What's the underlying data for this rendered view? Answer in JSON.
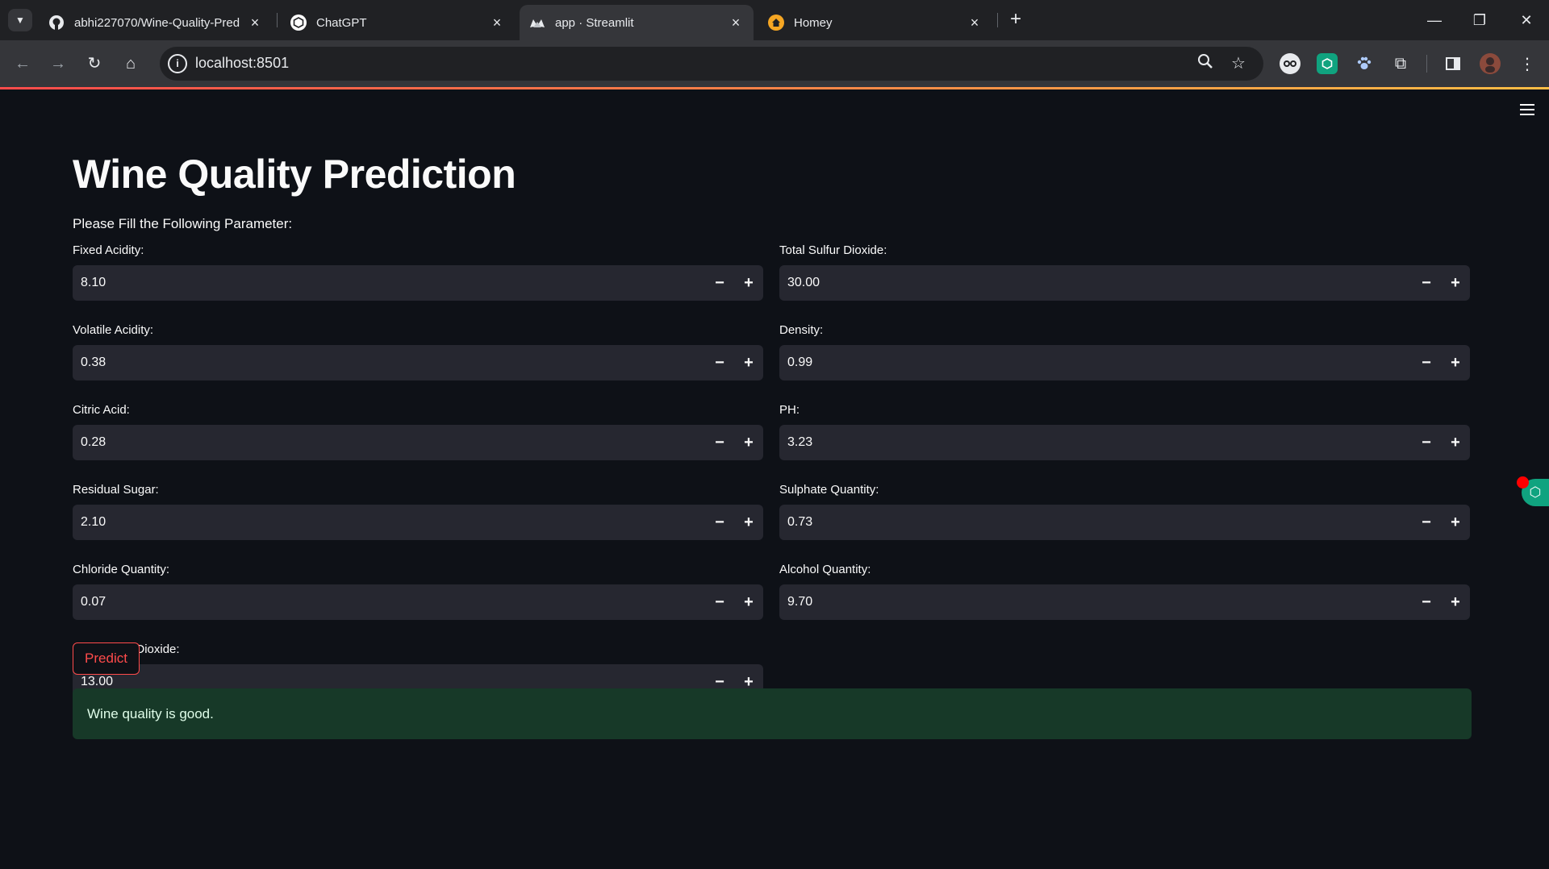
{
  "browser": {
    "tabs": [
      {
        "title": "abhi227070/Wine-Quality-Pred",
        "favicon": "github-icon"
      },
      {
        "title": "ChatGPT",
        "favicon": "chatgpt-icon"
      },
      {
        "title": "app · Streamlit",
        "favicon": "streamlit-icon",
        "active": true
      },
      {
        "title": "Homey",
        "favicon": "homey-icon"
      }
    ],
    "url": "localhost:8501"
  },
  "app": {
    "title": "Wine Quality Prediction",
    "subtitle": "Please Fill the Following Parameter:",
    "left_fields": [
      {
        "label": "Fixed Acidity:",
        "value": "8.10"
      },
      {
        "label": "Volatile Acidity:",
        "value": "0.38"
      },
      {
        "label": "Citric Acid:",
        "value": "0.28"
      },
      {
        "label": "Residual Sugar:",
        "value": "2.10"
      },
      {
        "label": "Chloride Quantity:",
        "value": "0.07"
      },
      {
        "label": "Free Sulfur Dioxide:",
        "value": "13.00"
      }
    ],
    "right_fields": [
      {
        "label": "Total Sulfur Dioxide:",
        "value": "30.00"
      },
      {
        "label": "Density:",
        "value": "0.99"
      },
      {
        "label": "PH:",
        "value": "3.23"
      },
      {
        "label": "Sulphate Quantity:",
        "value": "0.73"
      },
      {
        "label": "Alcohol Quantity:",
        "value": "9.70"
      }
    ],
    "predict_label": "Predict",
    "result": "Wine quality is good.",
    "stepper": {
      "minus": "−",
      "plus": "+"
    }
  },
  "colors": {
    "background": "#0e1117",
    "input_bg": "#262730",
    "accent": "#ff4b4b",
    "success_bg": "#173928"
  }
}
